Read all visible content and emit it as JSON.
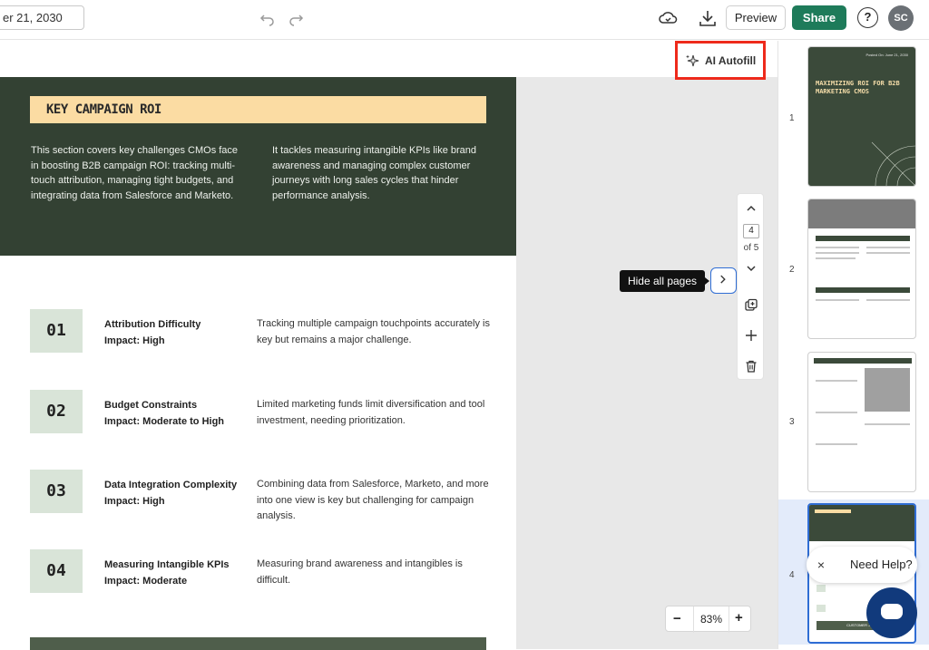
{
  "topbar": {
    "date_text": "er 21, 2030",
    "preview_label": "Preview",
    "share_label": "Share",
    "help_label": "?",
    "avatar_initials": "SC"
  },
  "autofill": {
    "label": "AI Autofill"
  },
  "page": {
    "section_title": "KEY CAMPAIGN ROI",
    "intro_left": "This section covers key challenges CMOs face in boosting B2B campaign ROI: tracking multi-touch attribution, managing tight budgets, and integrating data from Salesforce and Marketo.",
    "intro_right": "It tackles measuring intangible KPIs like brand awareness and managing complex customer journeys with long sales cycles that hinder performance analysis.",
    "rows": [
      {
        "num": "01",
        "title": "Attribution Difficulty",
        "impact": "Impact: High",
        "desc": "Tracking multiple campaign touchpoints accurately is key but remains a major challenge."
      },
      {
        "num": "02",
        "title": "Budget Constraints",
        "impact": "Impact: Moderate to High",
        "desc": "Limited marketing funds limit diversification and tool investment, needing prioritization."
      },
      {
        "num": "03",
        "title": "Data Integration Complexity",
        "impact": "Impact: High",
        "desc": "Combining data from Salesforce, Marketo, and more into one view is key but challenging for campaign analysis."
      },
      {
        "num": "04",
        "title": "Measuring Intangible KPIs",
        "impact": "Impact: Moderate",
        "desc": "Measuring brand awareness and intangibles is difficult."
      }
    ]
  },
  "page_nav": {
    "current": "4",
    "of_text": "of 5",
    "hide_tip": "Hide all pages"
  },
  "zoom": {
    "minus": "−",
    "value": "83%",
    "plus": "+"
  },
  "thumbnails": {
    "nums": [
      "1",
      "2",
      "3",
      "4"
    ],
    "t1_date": "Posted On: June 21, 2030",
    "t1_title": "MAXIMIZING ROI FOR B2B MARKETING CMOS",
    "t4_foot": "CUSTOMER JOURN"
  },
  "help": {
    "close": "×",
    "text": "Need Help?"
  },
  "colors": {
    "share": "#1e7b5a",
    "hero": "#334133",
    "banner": "#fbdca3",
    "highlight": "#ee2a1b"
  }
}
